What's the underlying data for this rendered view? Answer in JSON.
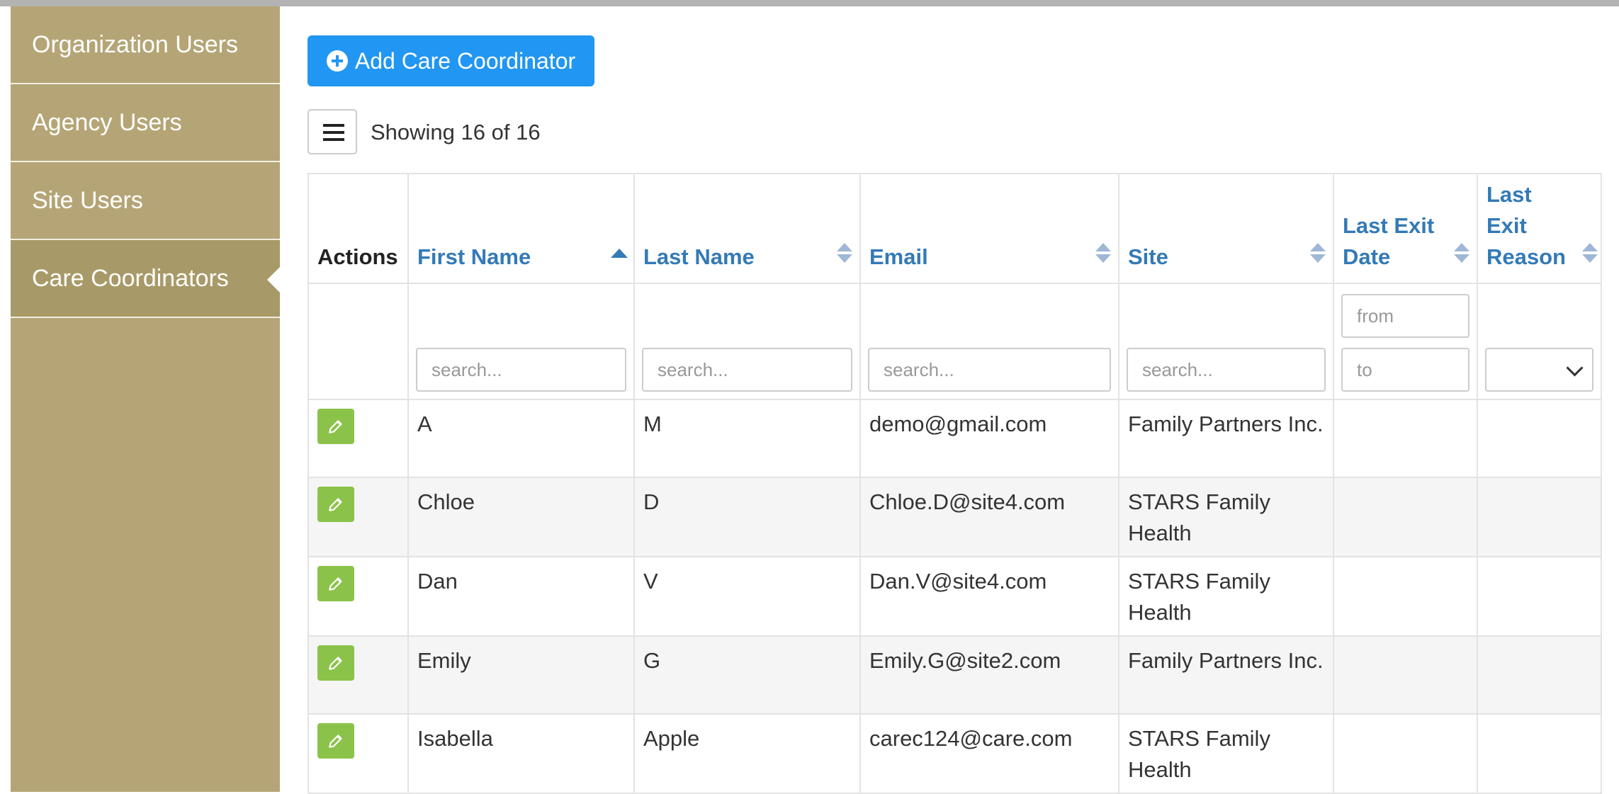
{
  "sidebar": {
    "items": [
      {
        "label": "Organization Users",
        "active": false
      },
      {
        "label": "Agency Users",
        "active": false
      },
      {
        "label": "Site Users",
        "active": false
      },
      {
        "label": "Care Coordinators",
        "active": true
      }
    ]
  },
  "toolbar": {
    "add_label": "Add Care Coordinator",
    "add_icon": "plus-circle-icon",
    "menu_icon": "hamburger-icon",
    "showing_text": "Showing 16 of 16"
  },
  "colors": {
    "sidebar_bg": "#b5a576",
    "sidebar_active_bg": "#a89a68",
    "primary_button": "#2196f3",
    "edit_button": "#8bc34a",
    "header_link": "#337ab7"
  },
  "table": {
    "columns": [
      {
        "label": "Actions",
        "sortable": false
      },
      {
        "label": "First Name",
        "sortable": true,
        "sort": "asc"
      },
      {
        "label": "Last Name",
        "sortable": true,
        "sort": "none"
      },
      {
        "label": "Email",
        "sortable": true,
        "sort": "none"
      },
      {
        "label": "Site",
        "sortable": true,
        "sort": "none"
      },
      {
        "label": "Last Exit Date",
        "sortable": true,
        "sort": "none"
      },
      {
        "label": "Last Exit Reason",
        "sortable": true,
        "sort": "none"
      }
    ],
    "filters": {
      "search_placeholder": "search...",
      "from_placeholder": "from",
      "to_placeholder": "to",
      "reason_selected": ""
    },
    "rows": [
      {
        "first": "A",
        "last": "M",
        "email": "demo@gmail.com",
        "site": "Family Partners Inc.",
        "exit_date": "",
        "exit_reason": ""
      },
      {
        "first": "Chloe",
        "last": "D",
        "email": "Chloe.D@site4.com",
        "site": "STARS Family Health",
        "exit_date": "",
        "exit_reason": ""
      },
      {
        "first": "Dan",
        "last": "V",
        "email": "Dan.V@site4.com",
        "site": "STARS Family Health",
        "exit_date": "",
        "exit_reason": ""
      },
      {
        "first": "Emily",
        "last": "G",
        "email": "Emily.G@site2.com",
        "site": "Family Partners Inc.",
        "exit_date": "",
        "exit_reason": ""
      },
      {
        "first": "Isabella",
        "last": "Apple",
        "email": "carec124@care.com",
        "site": "STARS Family Health",
        "exit_date": "",
        "exit_reason": ""
      }
    ]
  }
}
